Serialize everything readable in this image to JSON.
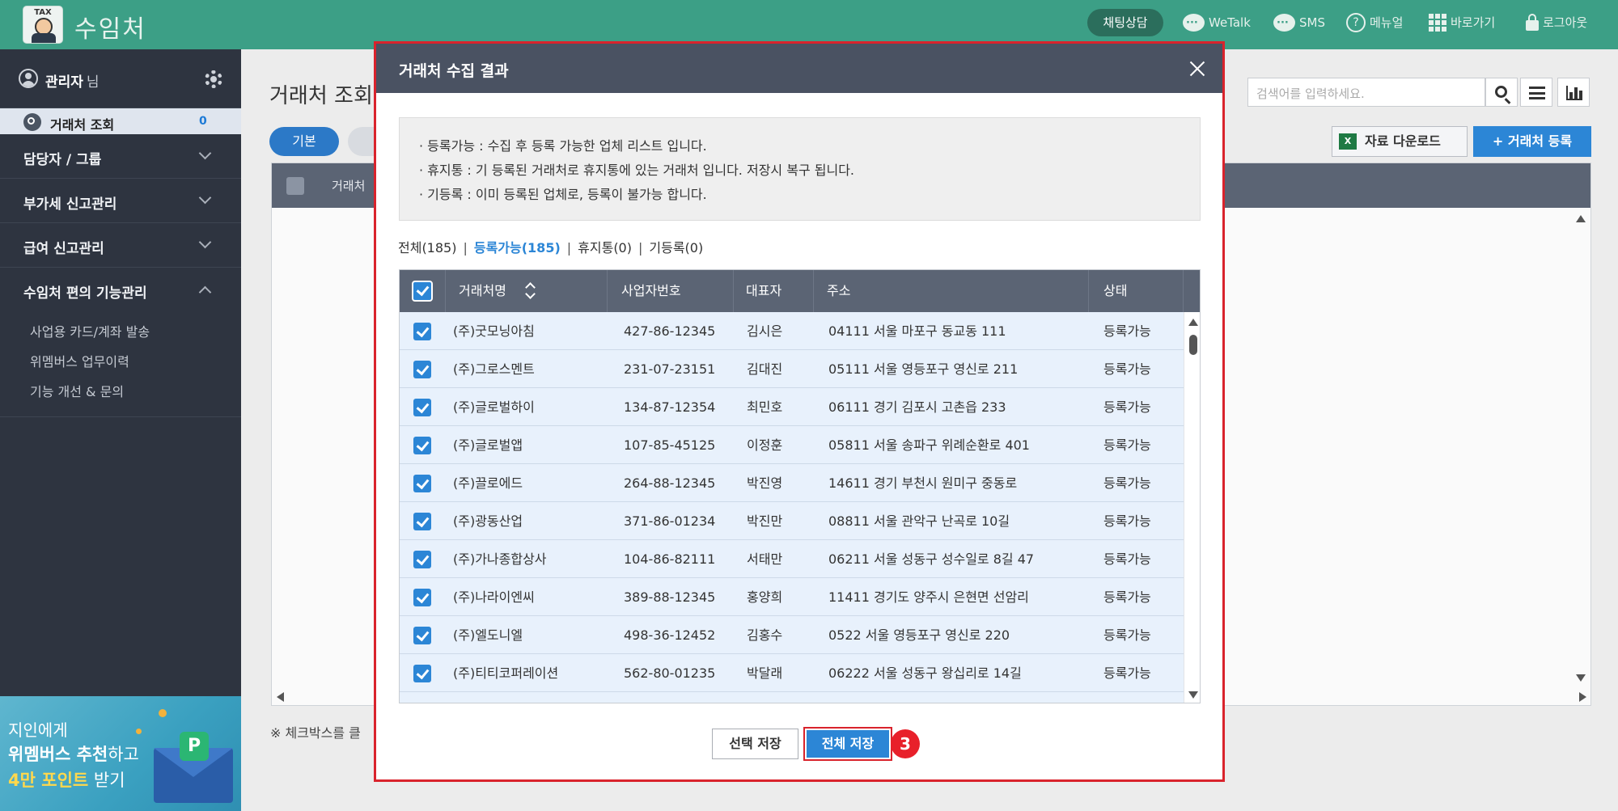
{
  "app": {
    "logo_tax": "TAX",
    "brand": "수임처"
  },
  "topbar": {
    "chat_label": "채팅상담",
    "wetalk_label": "WeTalk",
    "sms_label": "SMS",
    "manual_label": "메뉴얼",
    "shortcut_label": "바로가기",
    "logout_label": "로그아웃"
  },
  "sidebar": {
    "admin_name": "관리자",
    "admin_suffix": "님",
    "active_label": "거래처 조회",
    "active_count": "0",
    "sections": [
      {
        "label": "담당자 / 그룹"
      },
      {
        "label": "부가세 신고관리"
      },
      {
        "label": "급여 신고관리"
      },
      {
        "label": "수임처 편의 기능관리"
      }
    ],
    "sub_items": [
      "사업용 카드/계좌 발송",
      "위멤버스 업무이력",
      "기능 개선 & 문의"
    ],
    "banner": {
      "line1": "지인에게",
      "line2a": "위멤버스 추천",
      "line2b": "하고",
      "line3a": "4만 포인트",
      "line3b": " 받기",
      "pcard": "P"
    }
  },
  "main": {
    "title": "거래처 조회",
    "search_placeholder": "검색어를 입력하세요.",
    "tab_basic": "기본",
    "excel_icon": "X",
    "excel_label": "자료 다운로드",
    "register_label": "+ 거래처 등록",
    "bg_col": "거래처",
    "note": "※ 체크박스를 클"
  },
  "modal": {
    "title": "거래처 수집 결과",
    "info_lines": [
      "· 등록가능 : 수집 후 등록 가능한 업체 리스트 입니다.",
      "· 휴지통 : 기 등록된 거래처로 휴지통에 있는 거래처 입니다. 저장시 복구 됩니다.",
      "· 기등록 : 이미 등록된 업체로, 등록이 불가능 합니다."
    ],
    "filters": {
      "all": "전체(185)",
      "available": "등록가능(185)",
      "trash": "휴지통(0)",
      "registered": "기등록(0)"
    },
    "columns": {
      "name": "거래처명",
      "biz_no": "사업자번호",
      "ceo": "대표자",
      "address": "주소",
      "status": "상태"
    },
    "rows": [
      {
        "name": "(주)굿모닝아침",
        "biz_no": "427-86-12345",
        "ceo": "김시은",
        "address": "04111 서울 마포구 동교동 111",
        "status": "등록가능"
      },
      {
        "name": "(주)그로스멘트",
        "biz_no": "231-07-23151",
        "ceo": "김대진",
        "address": "05111 서울 영등포구 영신로 211",
        "status": "등록가능"
      },
      {
        "name": "(주)글로벌하이",
        "biz_no": "134-87-12354",
        "ceo": "최민호",
        "address": "06111 경기 김포시 고촌읍 233",
        "status": "등록가능"
      },
      {
        "name": "(주)글로벌앱",
        "biz_no": "107-85-45125",
        "ceo": "이정훈",
        "address": "05811 서울 송파구 위례순환로 401",
        "status": "등록가능"
      },
      {
        "name": "(주)끌로에드",
        "biz_no": "264-88-12345",
        "ceo": "박진영",
        "address": "14611 경기 부천시 원미구 중동로",
        "status": "등록가능"
      },
      {
        "name": "(주)광동산업",
        "biz_no": "371-86-01234",
        "ceo": "박진만",
        "address": "08811 서울 관악구 난곡로 10길",
        "status": "등록가능"
      },
      {
        "name": "(주)가나종합상사",
        "biz_no": "104-86-82111",
        "ceo": "서태만",
        "address": "06211 서울 성동구 성수일로 8길 47",
        "status": "등록가능"
      },
      {
        "name": "(주)나라이엔씨",
        "biz_no": "389-88-12345",
        "ceo": "홍양희",
        "address": "11411 경기도 양주시 은현면 선암리",
        "status": "등록가능"
      },
      {
        "name": "(주)엘도니엘",
        "biz_no": "498-36-12452",
        "ceo": "김홍수",
        "address": "0522 서울 영등포구 영신로 220",
        "status": "등록가능"
      },
      {
        "name": "(주)티티코퍼레이션",
        "biz_no": "562-80-01235",
        "ceo": "박달래",
        "address": "06222 서울 성동구 왕십리로 14길",
        "status": "등록가능"
      }
    ],
    "btn_select_save": "선택 저장",
    "btn_save_all": "전체 저장",
    "step_badge": "3"
  },
  "colors": {
    "topbar": "#3c9f86",
    "sidebar": "#2e3440",
    "modal_header": "#4a5262",
    "accent_blue": "#2c86d6",
    "highlight_red": "#d9232c",
    "row_selected": "#e8f1fc"
  }
}
